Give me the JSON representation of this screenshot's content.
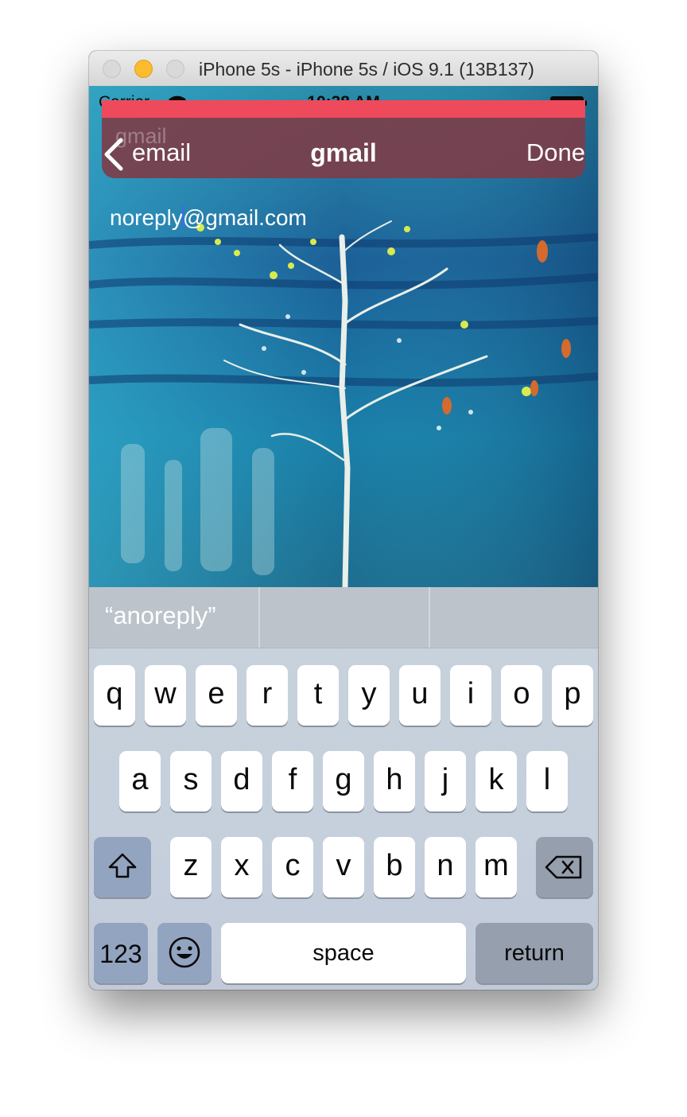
{
  "window": {
    "title": "iPhone 5s - iPhone 5s / iOS 9.1 (13B137)"
  },
  "status_bar": {
    "carrier": "Carrier",
    "time": "10:38 AM"
  },
  "navigation": {
    "ghost_label": "gmail",
    "back_label": "email",
    "title": "gmail",
    "done_label": "Done"
  },
  "content": {
    "email_before_cursor": "noreply",
    "email_after_cursor": "@gmail.com"
  },
  "keyboard": {
    "suggestions": [
      "“anoreply”",
      "",
      ""
    ],
    "row1": [
      "q",
      "w",
      "e",
      "r",
      "t",
      "y",
      "u",
      "i",
      "o",
      "p"
    ],
    "row2": [
      "a",
      "s",
      "d",
      "f",
      "g",
      "h",
      "j",
      "k",
      "l"
    ],
    "row3": [
      "z",
      "x",
      "c",
      "v",
      "b",
      "n",
      "m"
    ],
    "numbers_label": "123",
    "space_label": "space",
    "return_label": "return",
    "shift_icon": "shift-icon",
    "delete_icon": "delete-icon",
    "emoji_icon": "emoji-icon"
  }
}
